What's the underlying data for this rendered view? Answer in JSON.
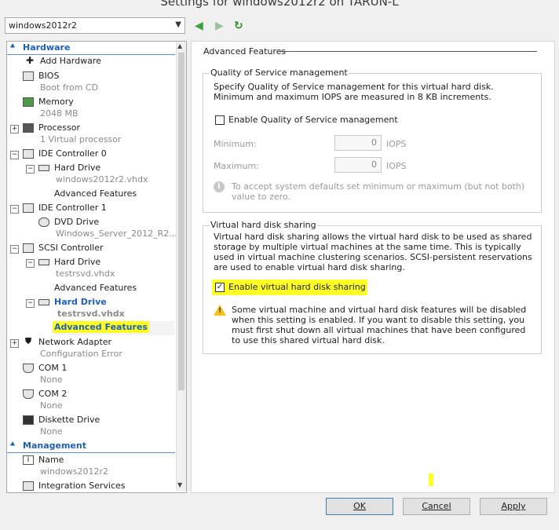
{
  "window": {
    "title": "Settings for windows2012r2 on TARUN-L"
  },
  "vm_selector": {
    "value": "windows2012r2"
  },
  "nav": {
    "back": "◀",
    "forward": "▶",
    "refresh": "↻"
  },
  "tree": {
    "hardware_header": "Hardware",
    "management_header": "Management",
    "items": {
      "add_hardware": "Add Hardware",
      "bios": "BIOS",
      "bios_sub": "Boot from CD",
      "memory": "Memory",
      "memory_sub": "2048 MB",
      "processor": "Processor",
      "processor_sub": "1 Virtual processor",
      "ide0": "IDE Controller 0",
      "ide0_hd": "Hard Drive",
      "ide0_hd_sub": "windows2012r2.vhdx",
      "ide0_adv": "Advanced Features",
      "ide1": "IDE Controller 1",
      "ide1_dvd": "DVD Drive",
      "ide1_dvd_sub": "Windows_Server_2012_R2...",
      "scsi": "SCSI Controller",
      "scsi_hd1": "Hard Drive",
      "scsi_hd1_sub": "testrsvd.vhdx",
      "scsi_hd1_adv": "Advanced Features",
      "scsi_hd2": "Hard Drive",
      "scsi_hd2_sub": "testrsvd.vhdx",
      "scsi_hd2_adv": "Advanced Features",
      "network": "Network Adapter",
      "network_sub": "Configuration Error",
      "com1": "COM 1",
      "com1_sub": "None",
      "com2": "COM 2",
      "com2_sub": "None",
      "diskette": "Diskette Drive",
      "diskette_sub": "None",
      "name": "Name",
      "name_sub": "windows2012r2",
      "integration": "Integration Services"
    }
  },
  "panel": {
    "title": "Advanced Features",
    "qos": {
      "group_title": "Quality of Service management",
      "description": "Specify Quality of Service management for this virtual hard disk. Minimum and maximum IOPS are measured in 8 KB increments.",
      "enable_label": "Enable Quality of Service management",
      "enabled": false,
      "minimum_label": "Minimum:",
      "minimum_value": "0",
      "maximum_label": "Maximum:",
      "maximum_value": "0",
      "unit": "IOPS",
      "info": "To accept system defaults set minimum or maximum (but not both) value to zero."
    },
    "sharing": {
      "group_title": "Virtual hard disk sharing",
      "description": "Virtual hard disk sharing allows the virtual hard disk to be used as shared storage by multiple virtual machines at the same time. This is typically used in virtual machine clustering scenarios. SCSI-persistent reservations are used to enable virtual hard disk sharing.",
      "enable_label": "Enable virtual hard disk sharing",
      "enabled": true,
      "warning": "Some virtual machine and virtual hard disk features will be disabled when this setting is enabled. If you want to disable this setting, you must first shut down all virtual machines that have been configured to use this shared virtual hard disk."
    }
  },
  "buttons": {
    "ok": "OK",
    "cancel": "Cancel",
    "apply": "Apply"
  },
  "colors": {
    "highlight": "#ffff26",
    "section_header": "#1f5fb5"
  }
}
